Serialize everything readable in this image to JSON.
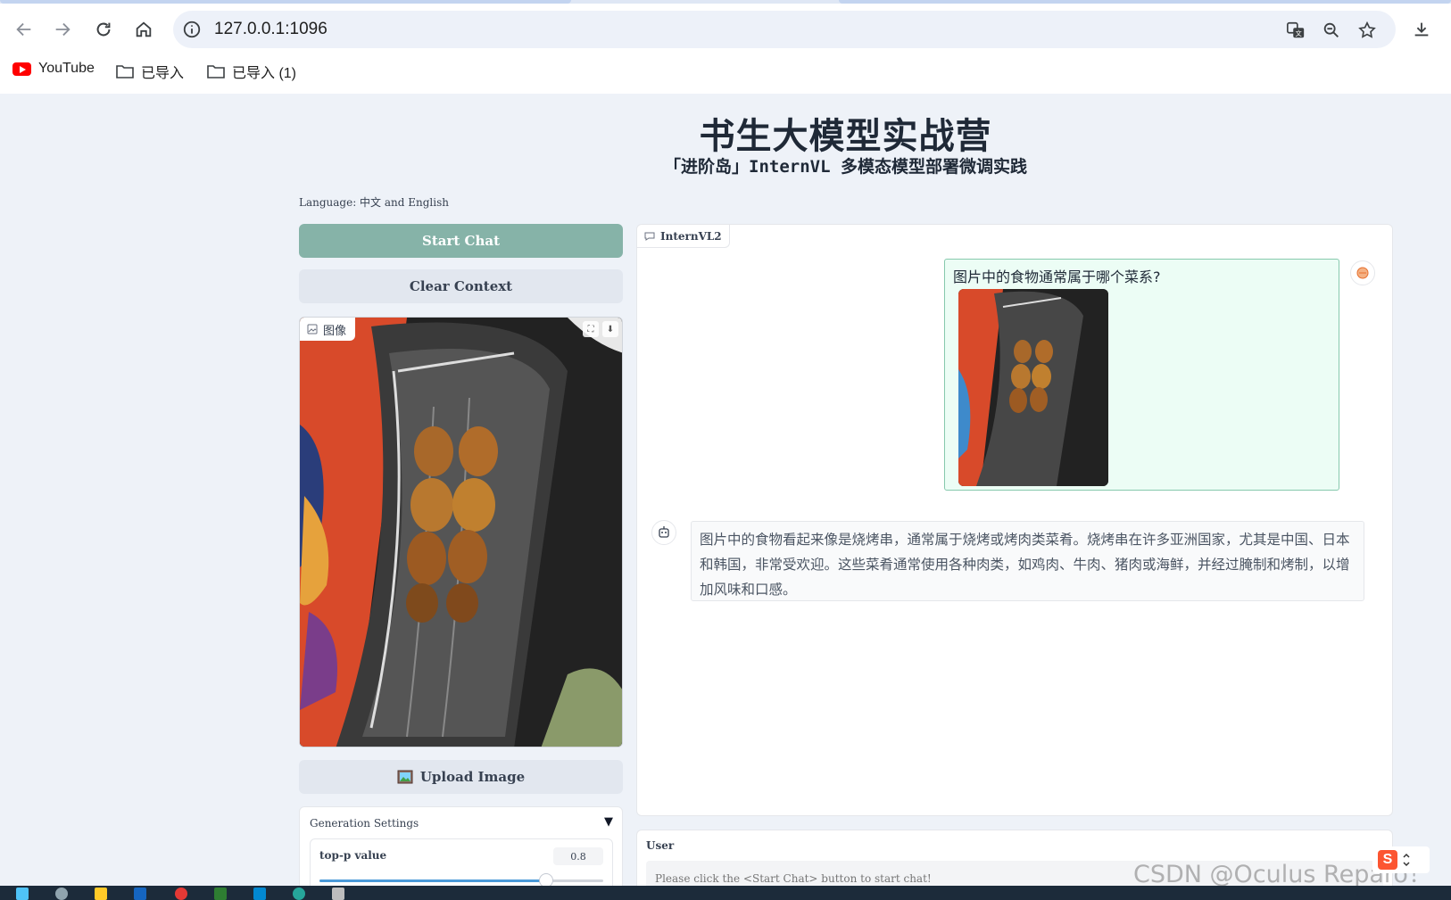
{
  "browser": {
    "url": "127.0.0.1:1096",
    "bookmarks": [
      {
        "label": "YouTube",
        "icon": "youtube-icon"
      },
      {
        "label": "已导入",
        "icon": "folder-icon"
      },
      {
        "label": "已导入 (1)",
        "icon": "folder-icon"
      }
    ]
  },
  "page": {
    "title": "书生大模型实战营",
    "subtitle": "「进阶岛」InternVL 多模态模型部署微调实践",
    "language_note": "Language: 中文 and English"
  },
  "controls": {
    "start_chat": "Start Chat",
    "clear_context": "Clear Context",
    "image_label": "图像",
    "upload_image": "Upload Image"
  },
  "generation": {
    "title": "Generation Settings",
    "toggle": "▼",
    "top_p_label": "top-p value",
    "top_p_value": "0.8",
    "top_p_fraction": 0.8
  },
  "chat": {
    "label": "InternVL2",
    "user_message": "图片中的食物通常属于哪个菜系?",
    "bot_message": "图片中的食物看起来像是烧烤串，通常属于烧烤或烤肉类菜肴。烧烤串在许多亚洲国家，尤其是中国、日本和韩国，非常受欢迎。这些菜肴通常使用各种肉类，如鸡肉、牛肉、猪肉或海鲜，并经过腌制和烤制，以增加风味和口感。"
  },
  "input": {
    "label": "User",
    "placeholder": "Please click the <Start Chat> button to start chat!"
  },
  "watermark": "CSDN @Oculus Reparo！",
  "colors": {
    "accent_green": "#86b3a8",
    "user_bubble": "#ecfdf5",
    "slider_blue": "#4b9ad8"
  }
}
